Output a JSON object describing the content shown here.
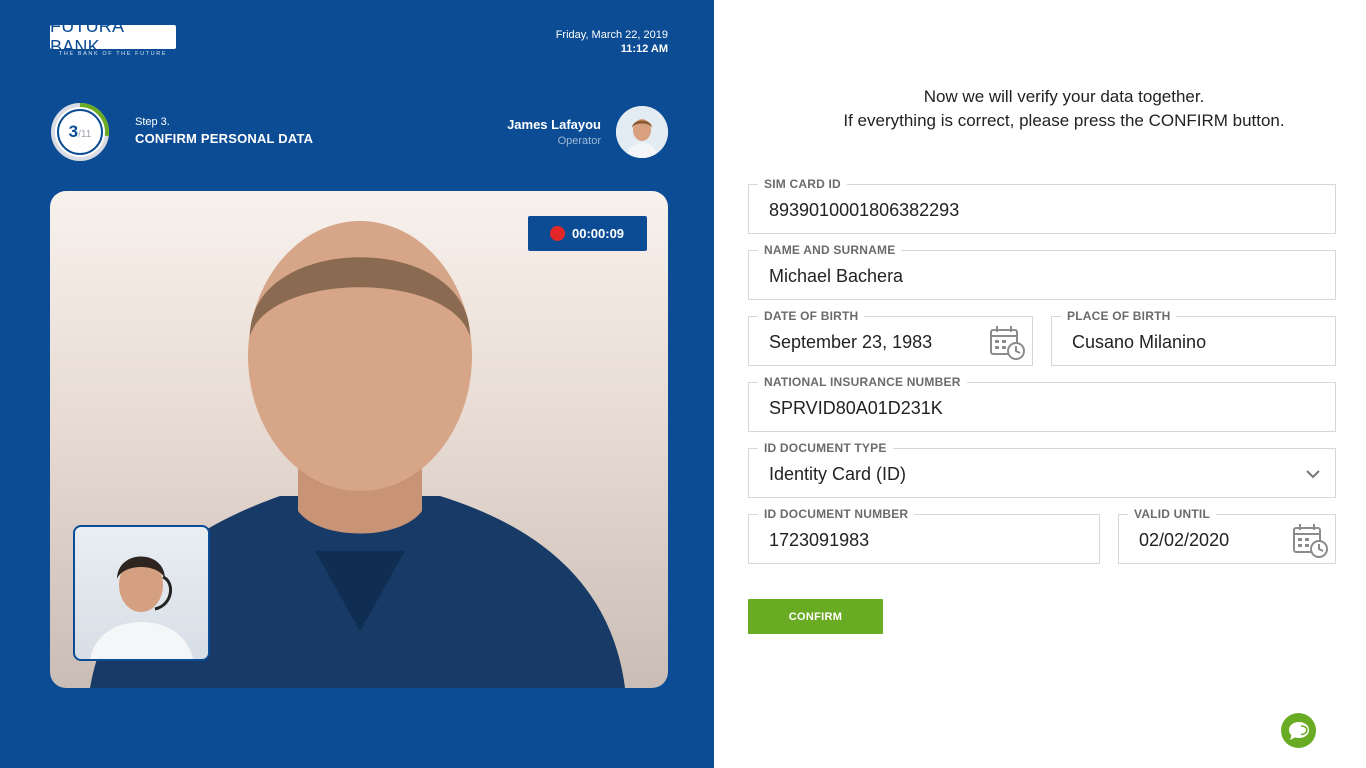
{
  "brand": {
    "name": "FUTURA BANK",
    "tagline": "THE BANK OF THE FUTURE"
  },
  "datetime": {
    "date": "Friday, March 22, 2019",
    "time": "11:12 AM"
  },
  "progress": {
    "current": "3",
    "total": "/11",
    "fraction": 0.2727
  },
  "step": {
    "number": "Step 3.",
    "title": "CONFIRM PERSONAL DATA"
  },
  "operator": {
    "name": "James Lafayou",
    "role": "Operator"
  },
  "recording": {
    "time": "00:00:09"
  },
  "intro": {
    "line1": "Now we will verify your data together.",
    "line2": "If everything is correct, please press the CONFIRM button."
  },
  "form": {
    "sim_card_id": {
      "label": "SIM CARD ID",
      "value": "8939010001806382293"
    },
    "name_surname": {
      "label": "NAME AND SURNAME",
      "value": "Michael Bachera"
    },
    "date_of_birth": {
      "label": "DATE OF BIRTH",
      "value": "September 23, 1983"
    },
    "place_of_birth": {
      "label": "PLACE OF BIRTH",
      "value": "Cusano Milanino"
    },
    "national_insurance": {
      "label": "NATIONAL INSURANCE NUMBER",
      "value": "SPRVID80A01D231K"
    },
    "id_doc_type": {
      "label": "ID DOCUMENT TYPE",
      "value": "Identity Card (ID)"
    },
    "id_doc_number": {
      "label": "ID DOCUMENT NUMBER",
      "value": "1723091983"
    },
    "valid_until": {
      "label": "VALID UNTIL",
      "value": "02/02/2020"
    }
  },
  "confirm_label": "CONFIRM",
  "colors": {
    "brand_blue": "#0b4c94",
    "accent_green": "#6aab24",
    "record_red": "#e32727"
  },
  "icons": [
    "calendar-clock-icon",
    "chevron-down-icon",
    "chat-icon",
    "record-dot-icon"
  ]
}
